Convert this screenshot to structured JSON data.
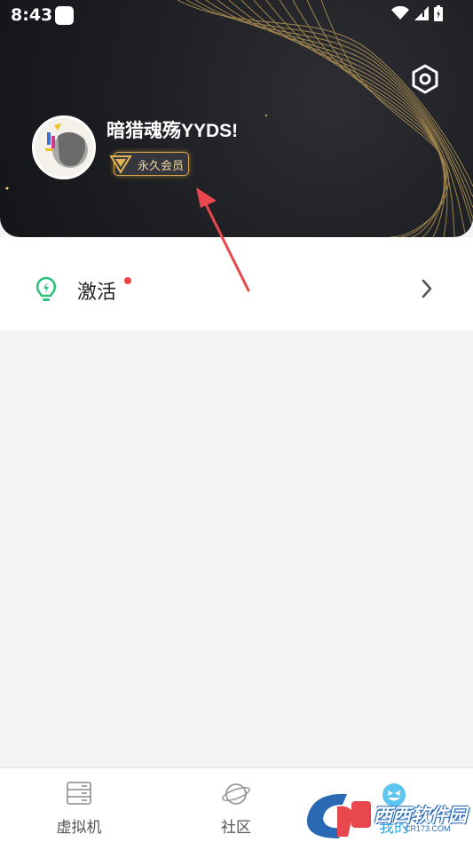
{
  "status_bar": {
    "time": "8:43"
  },
  "profile": {
    "username": "暗猎魂殇YYDS!",
    "badge": "永久会员"
  },
  "menu": {
    "items": [
      {
        "label": "激活",
        "has_red_dot": true,
        "icon": "lightbulb-icon"
      }
    ]
  },
  "bottom_nav": {
    "items": [
      {
        "label": "虚拟机",
        "icon": "server-rack-icon"
      },
      {
        "label": "社区",
        "icon": "planet-icon"
      },
      {
        "label": "我的",
        "icon": "smiley-icon"
      }
    ]
  },
  "watermark": {
    "brand": "西西软件园",
    "url": "CR173.COM"
  },
  "colors": {
    "header_bg": "#1d1f23",
    "gold": "#d9a84a",
    "accent_green": "#2ec27e",
    "accent_blue": "#2fa8e0",
    "annotation_red": "#e8484d"
  }
}
